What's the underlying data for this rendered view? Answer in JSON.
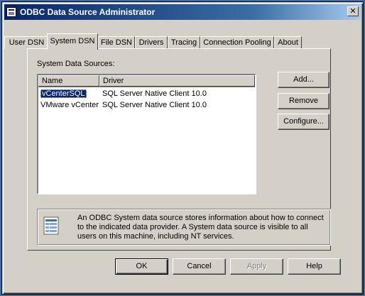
{
  "window": {
    "title": "ODBC Data Source Administrator",
    "close_label": "✕"
  },
  "tabs": [
    {
      "label": "User DSN"
    },
    {
      "label": "System DSN"
    },
    {
      "label": "File DSN"
    },
    {
      "label": "Drivers"
    },
    {
      "label": "Tracing"
    },
    {
      "label": "Connection Pooling"
    },
    {
      "label": "About"
    }
  ],
  "system_dsn": {
    "label": "System Data Sources:",
    "columns": [
      {
        "label": "Name"
      },
      {
        "label": "Driver"
      }
    ],
    "rows": [
      {
        "name": "vCenterSQL",
        "driver": "SQL Server Native Client 10.0",
        "selected": true
      },
      {
        "name": "VMware vCenter",
        "driver": "SQL Server Native Client 10.0",
        "selected": false
      }
    ],
    "buttons": {
      "add": "Add...",
      "remove": "Remove",
      "configure": "Configure..."
    },
    "info": "An ODBC System data source stores information about how to connect to the indicated data provider.   A System data source is visible to all users on this machine, including NT services."
  },
  "footer": {
    "ok": "OK",
    "cancel": "Cancel",
    "apply": "Apply",
    "help": "Help"
  },
  "colors": {
    "face": "#d4d0c8",
    "selection": "#0a246a",
    "title_start": "#0a246a",
    "desktop": "#3a6ea5"
  }
}
